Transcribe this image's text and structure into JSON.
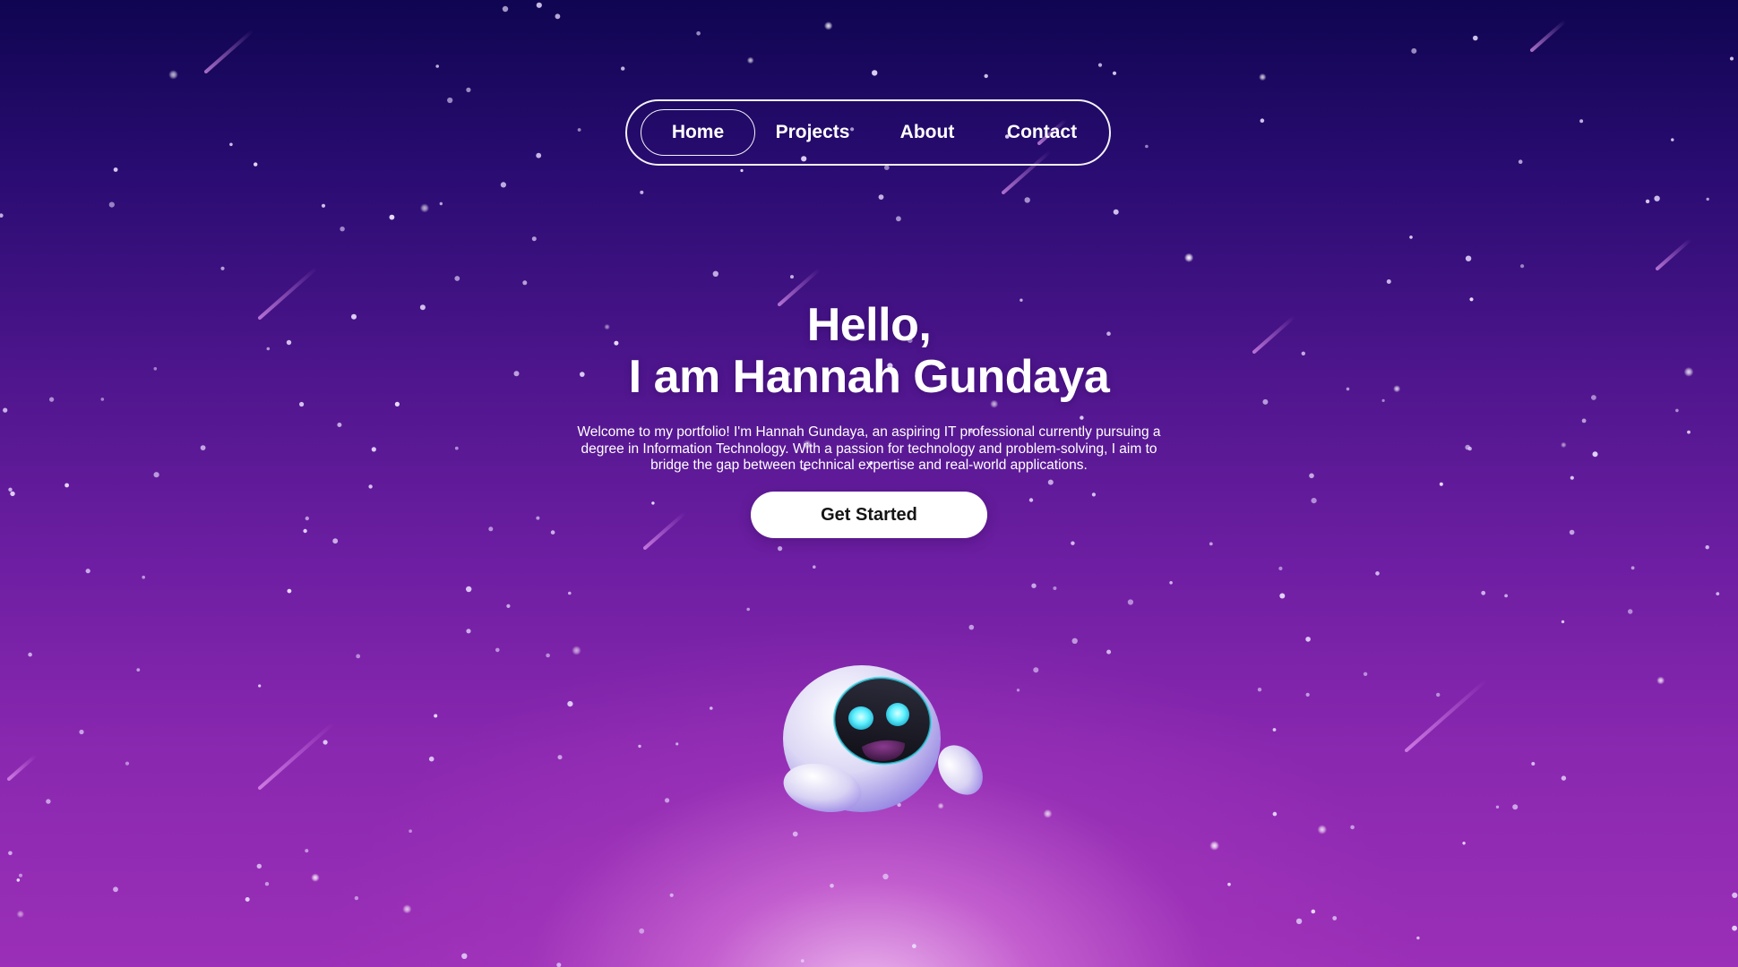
{
  "nav": {
    "items": [
      {
        "label": "Home",
        "active": true
      },
      {
        "label": "Projects",
        "active": false
      },
      {
        "label": "About",
        "active": false
      },
      {
        "label": "Contact",
        "active": false
      }
    ]
  },
  "hero": {
    "greeting": "Hello,",
    "name_line": "I am Hannah Gundaya",
    "description": "Welcome to my portfolio! I'm Hannah Gundaya, an aspiring IT professional currently pursuing a degree in Information Technology. With a passion for technology and problem-solving, I aim to bridge the gap between technical expertise and real-world applications.",
    "cta_label": "Get Started"
  },
  "mascot": {
    "icon": "robot-mascot-icon"
  },
  "colors": {
    "background_top": "#0f0551",
    "background_mid": "#6d1ea2",
    "background_bottom": "#9b2fb7",
    "glow": "#f0bef0",
    "robot_eyes": "#5ff0ff",
    "button_bg": "#ffffff",
    "button_text": "#141414"
  }
}
